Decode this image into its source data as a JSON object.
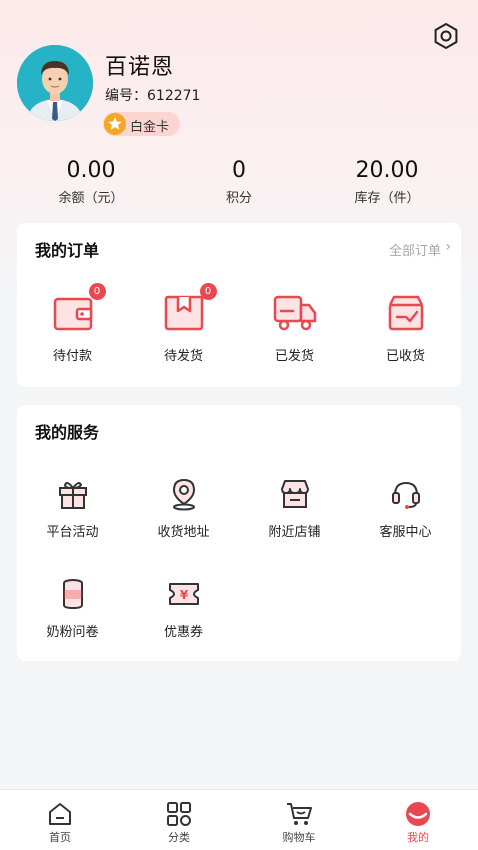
{
  "profile": {
    "name": "百诺恩",
    "id_label": "编号：612271",
    "badge": "白金卡"
  },
  "stats": [
    {
      "value": "0.00",
      "label": "余额（元）"
    },
    {
      "value": "0",
      "label": "积分"
    },
    {
      "value": "20.00",
      "label": "库存（件）"
    }
  ],
  "orders": {
    "title": "我的订单",
    "more": "全部订单",
    "items": [
      {
        "label": "待付款",
        "count": "0",
        "icon": "wallet-icon"
      },
      {
        "label": "待发货",
        "count": "0",
        "icon": "package-icon"
      },
      {
        "label": "已发货",
        "icon": "truck-icon"
      },
      {
        "label": "已收货",
        "icon": "received-box-icon"
      }
    ]
  },
  "services": {
    "title": "我的服务",
    "items": [
      {
        "label": "平台活动",
        "icon": "gift-icon"
      },
      {
        "label": "收货地址",
        "icon": "location-icon"
      },
      {
        "label": "附近店铺",
        "icon": "store-icon"
      },
      {
        "label": "客服中心",
        "icon": "headset-icon"
      },
      {
        "label": "奶粉问卷",
        "icon": "milk-can-icon"
      },
      {
        "label": "优惠券",
        "icon": "coupon-icon"
      }
    ]
  },
  "tabbar": [
    {
      "label": "首页",
      "icon": "home-icon"
    },
    {
      "label": "分类",
      "icon": "category-icon"
    },
    {
      "label": "购物车",
      "icon": "cart-icon"
    },
    {
      "label": "我的",
      "icon": "profile-icon",
      "active": true
    }
  ],
  "colors": {
    "accent": "#e84950",
    "badge": "#f5a623",
    "avatar_bg": "#27b3c6"
  }
}
